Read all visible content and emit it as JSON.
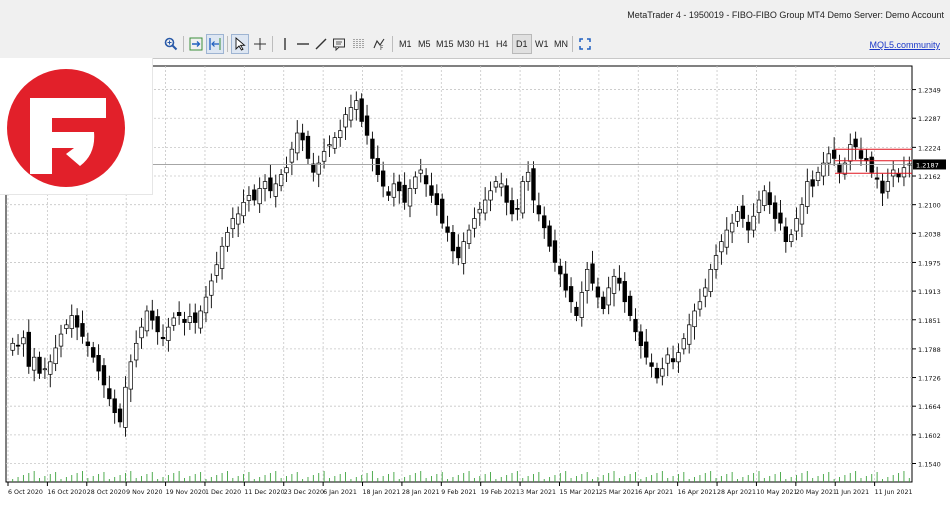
{
  "window": {
    "title": "MetaTrader 4 - 1950019 - FIBO-FIBO Group MT4 Demo Server: Demo Account"
  },
  "brand": {
    "logo_color": "#e2202a"
  },
  "toolbar": {
    "tools": [
      {
        "name": "zoom-in-icon",
        "active": false
      },
      {
        "name": "scroll-chart-icon",
        "active": false
      },
      {
        "name": "chart-shift-icon",
        "active": true
      },
      {
        "name": "cursor-icon",
        "active": true
      },
      {
        "name": "crosshair-icon",
        "active": false
      },
      {
        "name": "vertical-line-icon",
        "active": false
      },
      {
        "name": "horizontal-line-icon",
        "active": false
      },
      {
        "name": "trendline-icon",
        "active": false
      },
      {
        "name": "text-label-icon",
        "active": false
      },
      {
        "name": "fibonacci-icon",
        "active": false
      },
      {
        "name": "shapes-icon",
        "active": false
      }
    ],
    "timeframes": [
      "M1",
      "M5",
      "M15",
      "M30",
      "H1",
      "H4",
      "D1",
      "W1",
      "MN"
    ],
    "active_timeframe": "D1",
    "fullscreen_icon": "fullscreen-icon",
    "mql5_link": "MQL5.community"
  },
  "chart_data": {
    "type": "candlestick",
    "symbol_timeframe": "D1",
    "price_axis_labels": [
      "1.2349",
      "1.2287",
      "1.2224",
      "1.2162",
      "1.2100",
      "1.2038",
      "1.1975",
      "1.1913",
      "1.1851",
      "1.1788",
      "1.1726",
      "1.1664",
      "1.1602",
      "1.1540"
    ],
    "current_price": "1.2187",
    "date_axis_labels": [
      "6 Oct 2020",
      "16 Oct 2020",
      "28 Oct 2020",
      "9 Nov 2020",
      "19 Nov 2020",
      "1 Dec 2020",
      "11 Dec 2020",
      "23 Dec 2020",
      "6 Jan 2021",
      "18 Jan 2021",
      "28 Jan 2021",
      "9 Feb 2021",
      "19 Feb 2021",
      "3 Mar 2021",
      "15 Mar 2021",
      "25 Mar 2021",
      "6 Apr 2021",
      "16 Apr 2021",
      "28 Apr 2021",
      "10 May 2021",
      "20 May 2021",
      "1 Jun 2021",
      "11 Jun 2021"
    ],
    "ylim": [
      1.15,
      1.24
    ],
    "grid": true,
    "closes": [
      1.18,
      1.1795,
      1.1812,
      1.175,
      1.177,
      1.1735,
      1.1745,
      1.176,
      1.179,
      1.182,
      1.184,
      1.186,
      1.1835,
      1.1815,
      1.1795,
      1.177,
      1.174,
      1.171,
      1.168,
      1.165,
      1.163,
      1.1705,
      1.176,
      1.18,
      1.1835,
      1.187,
      1.185,
      1.1825,
      1.181,
      1.1835,
      1.1855,
      1.186,
      1.1845,
      1.1858,
      1.1845,
      1.187,
      1.19,
      1.1935,
      1.197,
      1.201,
      1.204,
      1.207,
      1.208,
      1.2105,
      1.212,
      1.211,
      1.2135,
      1.215,
      1.213,
      1.2145,
      1.2165,
      1.218,
      1.222,
      1.2255,
      1.224,
      1.22,
      1.217,
      1.219,
      1.2215,
      1.223,
      1.2245,
      1.226,
      1.2295,
      1.231,
      1.2325,
      1.228,
      1.225,
      1.22,
      1.2165,
      1.214,
      1.212,
      1.2145,
      1.213,
      1.2105,
      1.2135,
      1.216,
      1.2175,
      1.2145,
      1.212,
      1.21,
      1.206,
      1.204,
      1.2,
      1.1985,
      1.202,
      1.2045,
      1.207,
      1.209,
      1.211,
      1.213,
      1.215,
      1.2145,
      1.2105,
      1.208,
      1.209,
      1.215,
      1.217,
      1.211,
      1.208,
      1.205,
      1.201,
      1.1975,
      1.195,
      1.1915,
      1.189,
      1.186,
      1.191,
      1.196,
      1.193,
      1.19,
      1.1875,
      1.192,
      1.1945,
      1.193,
      1.189,
      1.186,
      1.1825,
      1.1795,
      1.177,
      1.175,
      1.1725,
      1.1745,
      1.1775,
      1.176,
      1.178,
      1.181,
      1.184,
      1.187,
      1.189,
      1.192,
      1.196,
      1.199,
      1.202,
      1.2045,
      1.206,
      1.2085,
      1.207,
      1.2045,
      1.2075,
      1.211,
      1.213,
      1.21,
      1.207,
      1.206,
      1.202,
      1.2035,
      1.207,
      1.21,
      1.215,
      1.214,
      1.217,
      1.219,
      1.221,
      1.22,
      1.217,
      1.219,
      1.223,
      1.2225,
      1.22,
      1.2195,
      1.217,
      1.2155,
      1.2125,
      1.215,
      1.2175,
      1.216,
      1.218,
      1.2187
    ]
  }
}
